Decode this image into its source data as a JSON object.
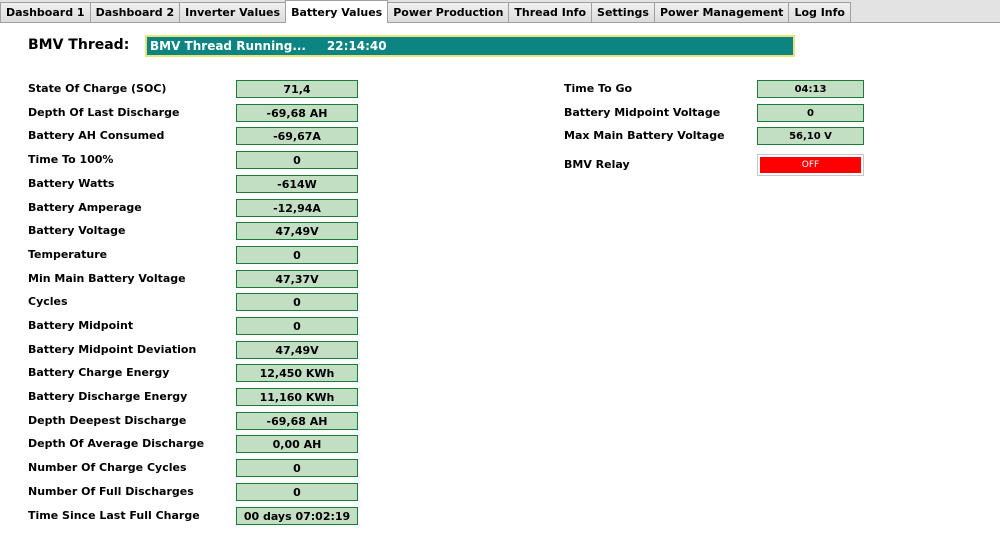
{
  "tabs": [
    {
      "label": "Dashboard 1",
      "active": false
    },
    {
      "label": "Dashboard 2",
      "active": false
    },
    {
      "label": "Inverter Values",
      "active": false
    },
    {
      "label": "Battery Values",
      "active": true
    },
    {
      "label": "Power Production",
      "active": false
    },
    {
      "label": "Thread Info",
      "active": false
    },
    {
      "label": "Settings",
      "active": false
    },
    {
      "label": "Power Management",
      "active": false
    },
    {
      "label": "Log Info",
      "active": false
    }
  ],
  "thread": {
    "label": "BMV Thread:",
    "status": "BMV Thread Running...     22:14:40"
  },
  "left_fields": [
    {
      "label": "State Of Charge (SOC)",
      "value": "71,4"
    },
    {
      "label": "Depth Of Last Discharge",
      "value": "-69,68 AH"
    },
    {
      "label": "Battery AH Consumed",
      "value": "-69,67A"
    },
    {
      "label": "Time To 100%",
      "value": "0"
    },
    {
      "label": "Battery Watts",
      "value": "-614W"
    },
    {
      "label": "Battery Amperage",
      "value": "-12,94A"
    },
    {
      "label": "Battery Voltage",
      "value": "47,49V"
    },
    {
      "label": "Temperature",
      "value": "0"
    },
    {
      "label": "Min Main Battery Voltage",
      "value": "47,37V"
    },
    {
      "label": "Cycles",
      "value": "0"
    },
    {
      "label": "Battery Midpoint",
      "value": "0"
    },
    {
      "label": "Battery Midpoint Deviation",
      "value": "47,49V"
    },
    {
      "label": "Battery Charge Energy",
      "value": "12,450 KWh"
    },
    {
      "label": "Battery Discharge Energy",
      "value": "11,160 KWh"
    },
    {
      "label": "Depth Deepest Discharge",
      "value": "-69,68 AH"
    },
    {
      "label": "Depth Of Average Discharge",
      "value": "0,00 AH"
    },
    {
      "label": "Number Of Charge Cycles",
      "value": "0"
    },
    {
      "label": "Number Of Full Discharges",
      "value": "0"
    },
    {
      "label": "Time Since Last Full Charge",
      "value": "00 days 07:02:19"
    }
  ],
  "right_fields": [
    {
      "label": "Time To Go",
      "value": "04:13"
    },
    {
      "label": "Battery Midpoint Voltage",
      "value": "0"
    },
    {
      "label": "Max Main Battery Voltage",
      "value": "56,10 V"
    }
  ],
  "relay": {
    "label": "BMV Relay",
    "value": "OFF",
    "color": "#ff0000"
  }
}
